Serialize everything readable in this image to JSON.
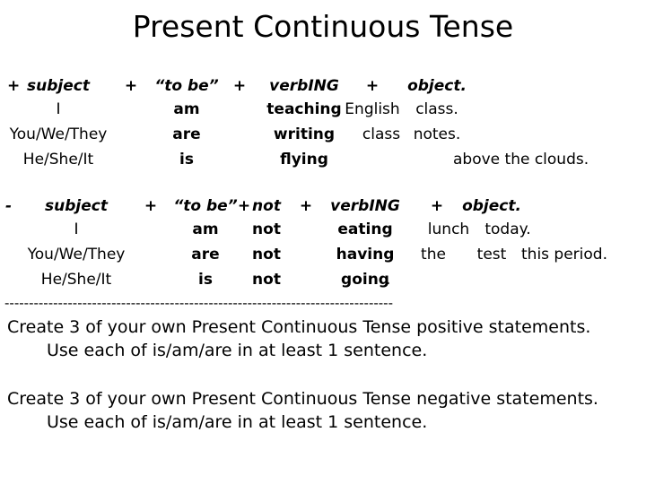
{
  "slide": {
    "title": "Present Continuous Tense",
    "background_color": "#ffffff",
    "text_color": "#000000"
  },
  "positive_table": {
    "sign": "+",
    "header": {
      "subject": "subject",
      "plus1": "+",
      "to_be": "“to be”",
      "plus2": "+",
      "verbing": "verbING",
      "plus3": "+",
      "object": "object."
    },
    "rows": [
      {
        "subject": "I",
        "to_be": "am",
        "verbing": "teaching",
        "object_a": "English",
        "object_b": "class."
      },
      {
        "subject": "You/We/They",
        "to_be": "are",
        "verbing": "writing",
        "object_a": "class",
        "object_b": "notes."
      },
      {
        "subject": "He/She/It",
        "to_be": "is",
        "verbing": "flying",
        "object_a": "",
        "object_b": "above the clouds."
      }
    ]
  },
  "negative_table": {
    "sign": "-",
    "header": {
      "subject": "subject",
      "plus1": "+",
      "to_be": "“to be”",
      "plus_not": "+",
      "not": "not",
      "plus2": "+",
      "verbing": "verbING",
      "plus3": "+",
      "object": "object."
    },
    "rows": [
      {
        "subject": "I",
        "to_be": "am",
        "not": "not",
        "verbing": "eating",
        "verbing_suffix": "",
        "object_a": "",
        "object_b": "lunch",
        "object_c": "today."
      },
      {
        "subject": "You/We/They",
        "to_be": "are",
        "not": "not",
        "verbing": "having",
        "verbing_suffix": "",
        "object_a": "the",
        "object_b": "test",
        "object_c": "this period."
      },
      {
        "subject": "He/She/It",
        "to_be": "is",
        "not": "not",
        "verbing": "going",
        "verbing_suffix": ".",
        "object_a": "",
        "object_b": "",
        "object_c": ""
      }
    ]
  },
  "divider": {
    "text": "--------------------------------------------------------------------------------"
  },
  "instructions_positive": {
    "line1": "Create 3 of your own  Present Continuous Tense  positive statements.",
    "line2": "Use each of is/am/are in at least 1 sentence."
  },
  "instructions_negative": {
    "line1": "Create 3 of your own  Present Continuous Tense  negative statements.",
    "line2": "Use each of is/am/are in at least 1 sentence."
  }
}
